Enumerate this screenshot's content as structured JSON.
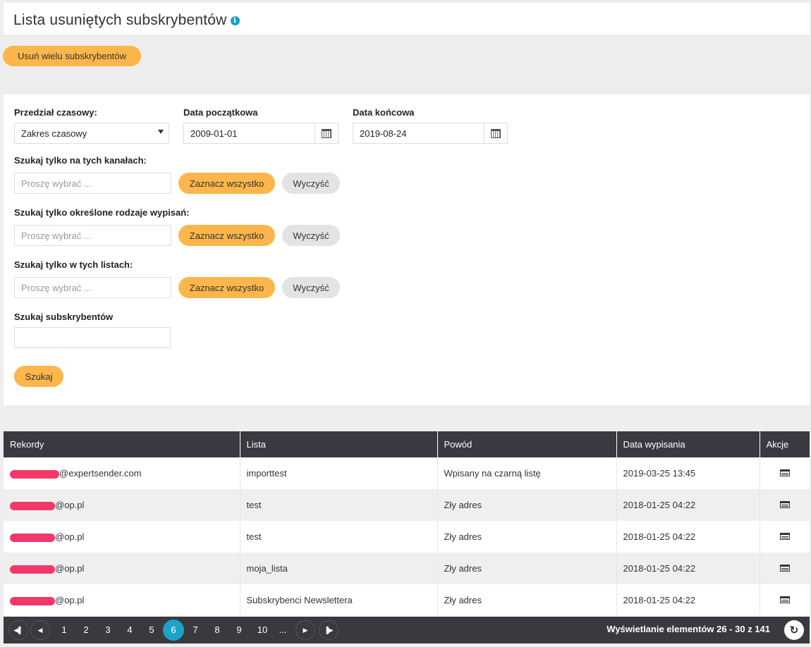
{
  "page": {
    "title": "Lista usuniętych subskrybentów",
    "info_icon": "i"
  },
  "toolbar": {
    "bulk_delete_label": "Usuń wielu subskrybentów"
  },
  "filters": {
    "range_label": "Przedział czasowy:",
    "range_value": "Zakres czasowy",
    "start_label": "Data początkowa",
    "start_value": "2009-01-01",
    "end_label": "Data końcowa",
    "end_value": "2019-08-24",
    "channels_label": "Szukaj tylko na tych kanałach:",
    "types_label": "Szukaj tylko określone rodzaje wypisań:",
    "lists_label": "Szukaj tylko w tych listach:",
    "placeholder": "Proszę wybrać ...",
    "select_all_label": "Zaznacz wszystko",
    "clear_label": "Wyczyść",
    "search_label": "Szukaj subskrybentów",
    "search_value": "",
    "search_button": "Szukaj"
  },
  "table": {
    "columns": [
      "Rekordy",
      "Lista",
      "Powód",
      "Data wypisania",
      "Akcje"
    ],
    "rows": [
      {
        "email_suffix": "@expertsender.com",
        "list": "importtest",
        "reason": "Wpisany na czarną listę",
        "date": "2019-03-25 13:45"
      },
      {
        "email_suffix": "@op.pl",
        "list": "test",
        "reason": "Zły adres",
        "date": "2018-01-25 04:22"
      },
      {
        "email_suffix": "@op.pl",
        "list": "test",
        "reason": "Zły adres",
        "date": "2018-01-25 04:22"
      },
      {
        "email_suffix": "@op.pl",
        "list": "moja_lista",
        "reason": "Zły adres",
        "date": "2018-01-25 04:22"
      },
      {
        "email_suffix": "@op.pl",
        "list": "Subskrybenci Newslettera",
        "reason": "Zły adres",
        "date": "2018-01-25 04:22"
      }
    ]
  },
  "pager": {
    "pages": [
      "1",
      "2",
      "3",
      "4",
      "5",
      "6",
      "7",
      "8",
      "9",
      "10",
      "..."
    ],
    "current": "6",
    "info": "Wyświetlanie elementów 26 - 30 z 141"
  },
  "colors": {
    "accent_orange": "#fdb64b",
    "header_dark": "#383a40",
    "active_page": "#1ca3c6",
    "redaction": "#f2386a"
  }
}
